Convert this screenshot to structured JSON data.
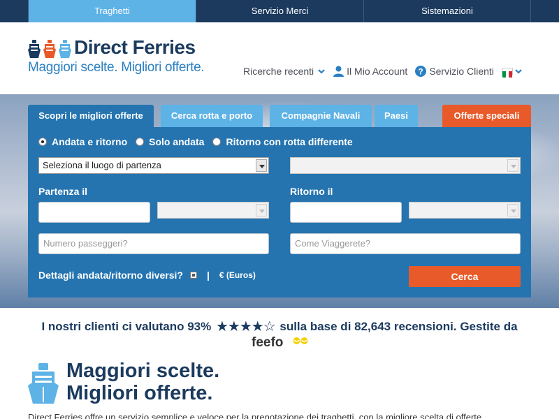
{
  "topnav": {
    "tabs": [
      "Traghetti",
      "Servizio Merci",
      "Sistemazioni"
    ]
  },
  "header": {
    "logo_name": "Direct Ferries",
    "logo_tagline": "Maggiori scelte. Migliori offerte.",
    "links": {
      "recent": "Ricerche recenti",
      "account": "Il Mio Account",
      "support": "Servizio Clienti"
    }
  },
  "search": {
    "tabs": [
      "Scopri le migliori offerte",
      "Cerca rotta e porto",
      "Compagnie Navali",
      "Paesi",
      "Offerte speciali"
    ],
    "radios": [
      "Andata e ritorno",
      "Solo andata",
      "Ritorno con rotta differente"
    ],
    "departure_select": "Seleziona il luogo di partenza",
    "departure_label": "Partenza il",
    "return_label": "Ritorno il",
    "passengers_placeholder": "Numero passeggeri?",
    "travel_placeholder": "Come Viaggerete?",
    "details_label": "Dettagli andata/ritorno diversi?",
    "separator": "|",
    "currency": "€ (Euros)",
    "search_button": "Cerca"
  },
  "reviews": {
    "prefix": "I nostri clienti ci valutano 93%",
    "stars": "★★★★☆",
    "suffix": "sulla base di 82,643 recensioni. Gestite da",
    "brand": "feefo"
  },
  "bottom": {
    "title_line1": "Maggiori scelte.",
    "title_line2": "Migliori offerte.",
    "paragraph": "Direct Ferries offre un servizio semplice e veloce per la prenotazione dei traghetti, con la migliore scelta di offerte"
  }
}
